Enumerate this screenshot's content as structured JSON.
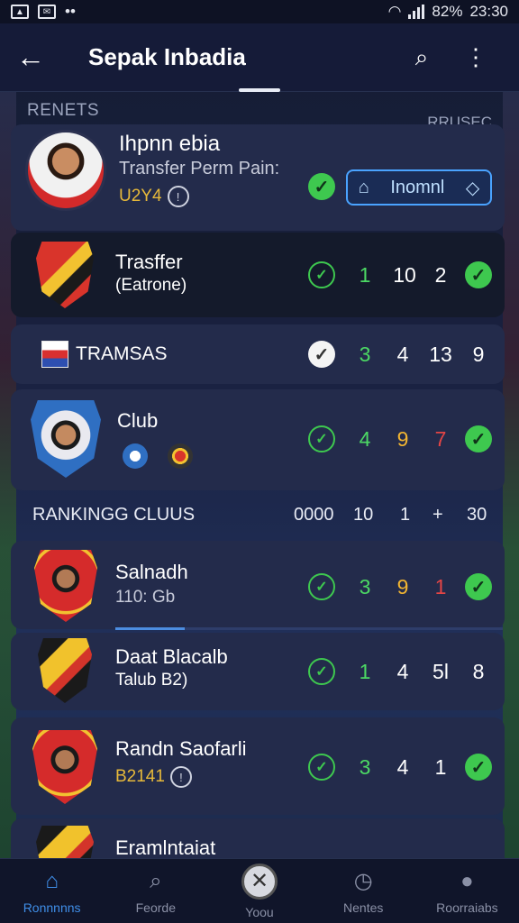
{
  "status_bar": {
    "battery": "82%",
    "time": "23:30"
  },
  "app_bar": {
    "back_icon": "arrow-left-icon",
    "title": "Sepak Inbadia"
  },
  "sections": {
    "left": "RENETS",
    "right": "RRUSEC"
  },
  "profile": {
    "name": "Ihpnn ebia",
    "subtitle": "Transfer Perm Pain:",
    "code": "U2Y4",
    "button_label": "Inomnl"
  },
  "rows": [
    {
      "name": "Trasffer",
      "sub": "(Eatrone)",
      "stats": [
        "1",
        "10",
        "2"
      ]
    },
    {
      "name": "TRAMSAS",
      "stats": [
        "3",
        "4",
        "13",
        "9"
      ]
    },
    {
      "name": "Club",
      "stats": [
        "4",
        "9",
        "7"
      ]
    }
  ],
  "ranking": {
    "label": "RANKINGG CLUUS",
    "cols": [
      "0000",
      "10",
      "1",
      "+",
      "30"
    ],
    "progress": 0.18
  },
  "clubs": [
    {
      "name": "Salnadh",
      "sub": "110: Gb",
      "stats": [
        "3",
        "9",
        "1"
      ]
    },
    {
      "name": "Daat Blacalb",
      "sub": "Talub B2)",
      "stats": [
        "1",
        "4",
        "5l",
        "8"
      ]
    },
    {
      "name": "Randn Saofarli",
      "sub": "B2141",
      "stats": [
        "3",
        "4",
        "1"
      ]
    },
    {
      "name": "Eramlntaiat"
    }
  ],
  "bottom_nav": [
    {
      "label": "Ronnnnns",
      "icon": "home-icon"
    },
    {
      "label": "Feorde",
      "icon": "search-icon"
    },
    {
      "label": "Yoou",
      "icon": "ball-icon"
    },
    {
      "label": "Nentes",
      "icon": "clock-icon"
    },
    {
      "label": "Roorraiabs",
      "icon": "profile-icon"
    }
  ]
}
